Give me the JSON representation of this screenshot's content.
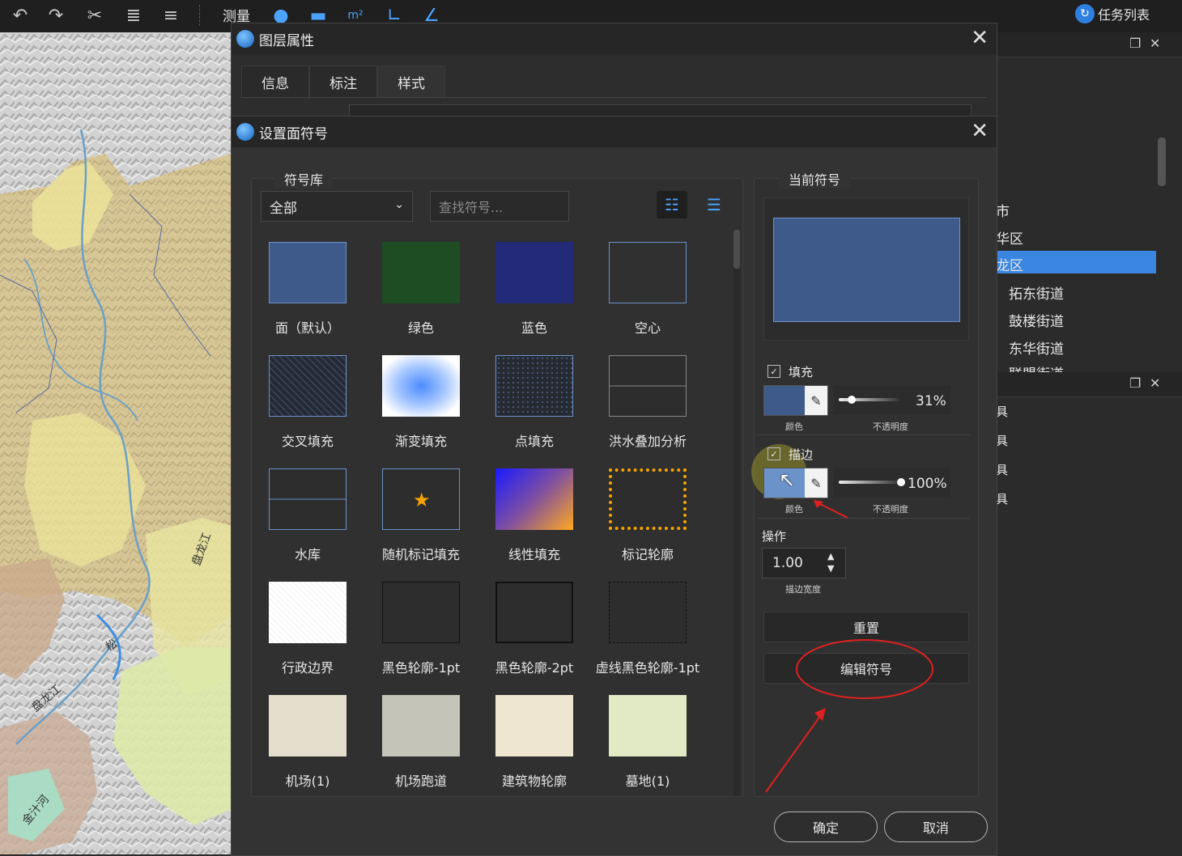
{
  "toolbar": {
    "measure_label": "测量",
    "task_list_label": "任务列表"
  },
  "right_dock": {
    "tree_items": [
      "市",
      "华区",
      "龙区",
      "拓东街道",
      "鼓楼街道",
      "东华街道",
      "联盟街道"
    ],
    "selected_index": 2,
    "lower_items": [
      "具",
      "具",
      "具",
      "具"
    ]
  },
  "map": {
    "labels": [
      "盘龙江",
      "松",
      "盘龙江",
      "金汁河"
    ]
  },
  "layer_dialog": {
    "title": "图层属性",
    "tabs": [
      "信息",
      "标注",
      "样式"
    ],
    "active_tab": 2
  },
  "symbol_dialog": {
    "title": "设置面符号",
    "library_group_title": "符号库",
    "category_value": "全部",
    "search_placeholder": "查找符号...",
    "symbols": [
      {
        "label": "面（默认）",
        "style": "default"
      },
      {
        "label": "绿色",
        "style": "green"
      },
      {
        "label": "蓝色",
        "style": "blue"
      },
      {
        "label": "空心",
        "style": "hollow"
      },
      {
        "label": "交叉填充",
        "style": "cross"
      },
      {
        "label": "渐变填充",
        "style": "gradient"
      },
      {
        "label": "点填充",
        "style": "dots"
      },
      {
        "label": "洪水叠加分析",
        "style": "flood"
      },
      {
        "label": "水库",
        "style": "reservoir"
      },
      {
        "label": "随机标记填充",
        "style": "star"
      },
      {
        "label": "线性填充",
        "style": "linear"
      },
      {
        "label": "标记轮廓",
        "style": "markers"
      },
      {
        "label": "行政边界",
        "style": "admin"
      },
      {
        "label": "黑色轮廓-1pt",
        "style": "black1"
      },
      {
        "label": "黑色轮廓-2pt",
        "style": "black2"
      },
      {
        "label": "虚线黑色轮廓-1pt",
        "style": "dashed"
      },
      {
        "label": "机场(1)",
        "style": "airport"
      },
      {
        "label": "机场跑道",
        "style": "runway"
      },
      {
        "label": "建筑物轮廓",
        "style": "building"
      },
      {
        "label": "墓地(1)",
        "style": "cemetery"
      }
    ],
    "current_group_title": "当前符号",
    "current_color": "#3d5a8a",
    "fill": {
      "label": "填充",
      "checked": true,
      "color": "#3d5a8a",
      "color_label": "颜色",
      "opacity_label": "不透明度",
      "opacity_text": "31%",
      "opacity_value": 0.31
    },
    "stroke": {
      "label": "描边",
      "checked": true,
      "color": "#6b93c9",
      "color_label": "颜色",
      "opacity_label": "不透明度",
      "opacity_text": "100%",
      "opacity_value": 1.0
    },
    "operation_label": "操作",
    "stroke_width_value": "1.00",
    "stroke_width_label": "描边宽度",
    "reset_label": "重置",
    "edit_label": "编辑符号",
    "ok_label": "确定",
    "cancel_label": "取消"
  }
}
